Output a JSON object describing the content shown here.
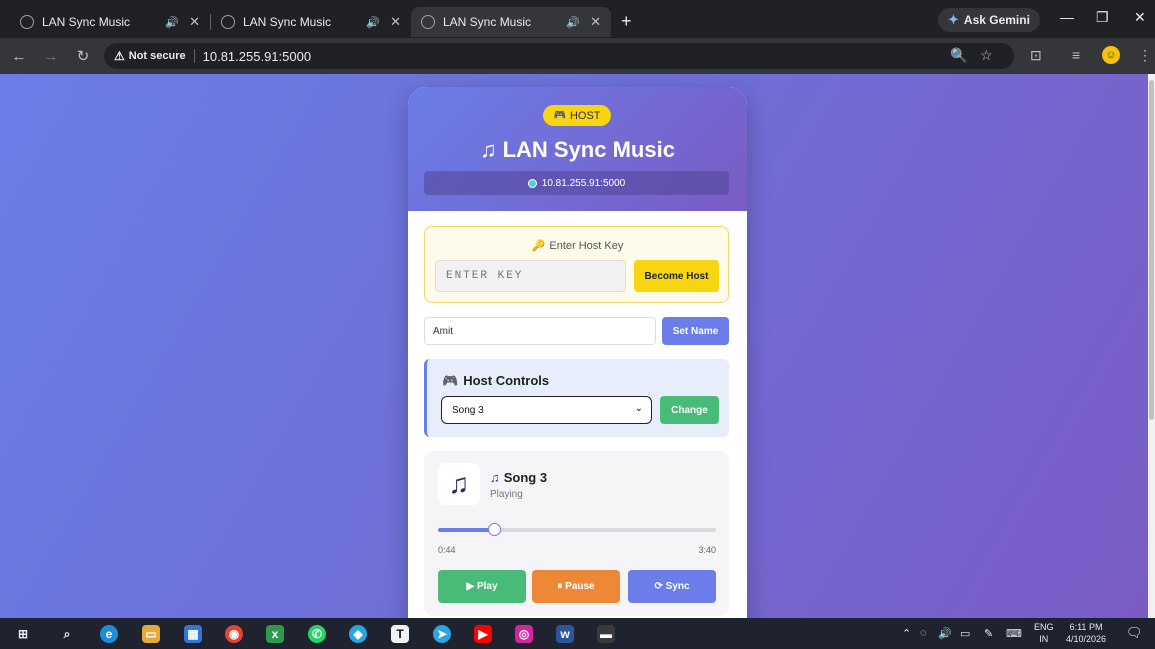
{
  "browser": {
    "tabs": [
      {
        "title": "LAN Sync Music",
        "active": false
      },
      {
        "title": "LAN Sync Music",
        "active": false
      },
      {
        "title": "LAN Sync Music",
        "active": true
      }
    ],
    "ask_gemini": "Ask Gemini",
    "not_secure": "Not secure",
    "url": "10.81.255.91:5000"
  },
  "app": {
    "badge": "HOST",
    "title": "LAN Sync Music",
    "ip": "10.81.255.91:5000",
    "host_key": {
      "label": "Enter Host Key",
      "placeholder": "ENTER KEY",
      "button": "Become Host"
    },
    "name": {
      "value": "Amit",
      "button": "Set Name"
    },
    "host_controls": {
      "title": "Host Controls",
      "selected_song": "Song 3",
      "button": "Change"
    },
    "player": {
      "song": "Song 3",
      "status": "Playing",
      "current_time": "0:44",
      "total_time": "3:40",
      "progress": 0.2,
      "play": "▶ Play",
      "pause": "⏸ Pause",
      "sync": "Sync"
    }
  },
  "taskbar": {
    "lang_top": "ENG",
    "lang_bottom": "IN",
    "time": "6:11 PM",
    "date": "4/10/2026"
  },
  "colors": {
    "accent": "#6a7de8",
    "gold": "#f7d511",
    "green": "#48bb78",
    "orange": "#ed8936"
  }
}
